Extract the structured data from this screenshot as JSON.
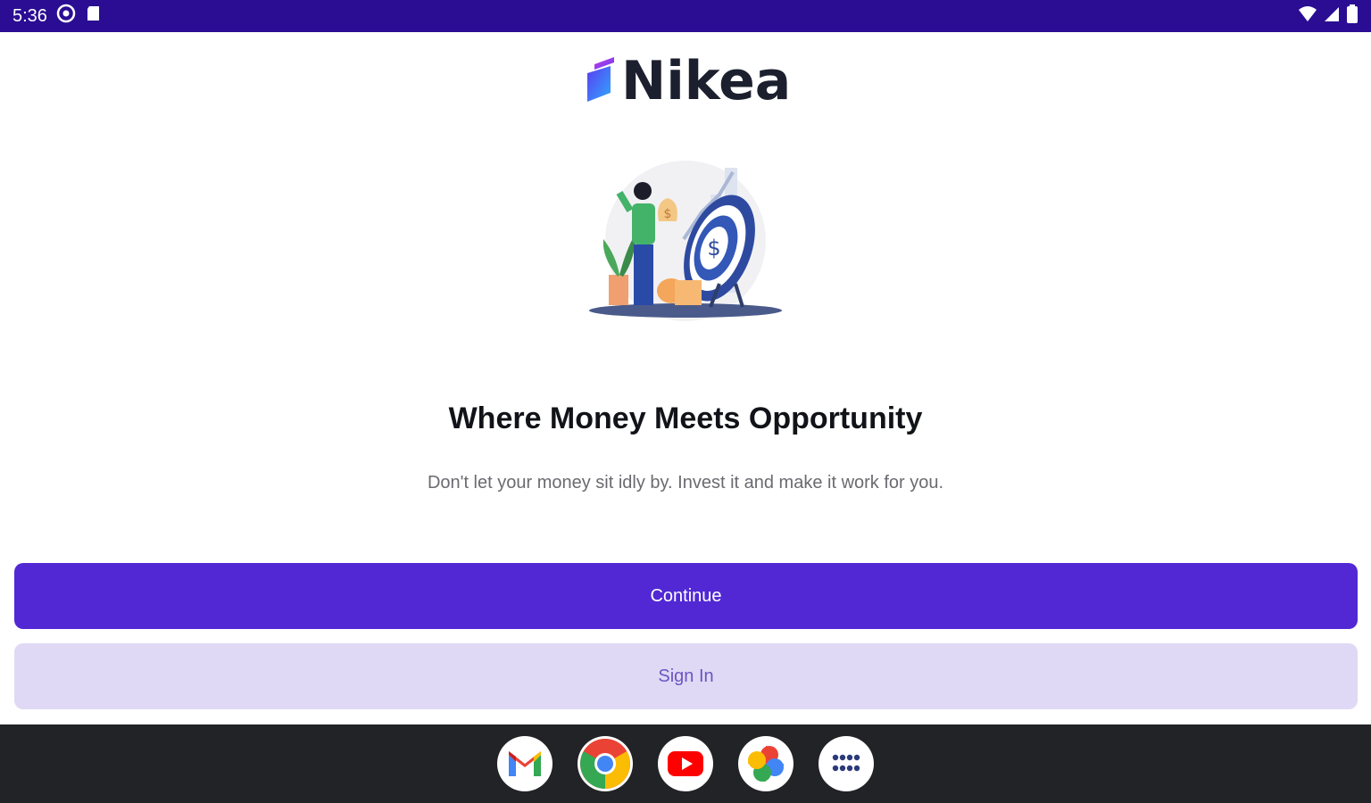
{
  "status_bar": {
    "time": "5:36",
    "icons": [
      "settings-gear-icon",
      "sd-card-icon",
      "wifi-icon",
      "cell-signal-icon",
      "battery-icon"
    ]
  },
  "app": {
    "name": "Nikea",
    "brand_color": "#5128d4"
  },
  "hero": {
    "headline": "Where Money Meets Opportunity",
    "subhead": "Don't let your money sit idly by. Invest it and make it work for you."
  },
  "actions": {
    "continue_label": "Continue",
    "signin_label": "Sign In"
  },
  "dock": {
    "apps": [
      "gmail-icon",
      "chrome-icon",
      "youtube-icon",
      "photos-icon",
      "app-drawer-icon"
    ]
  }
}
